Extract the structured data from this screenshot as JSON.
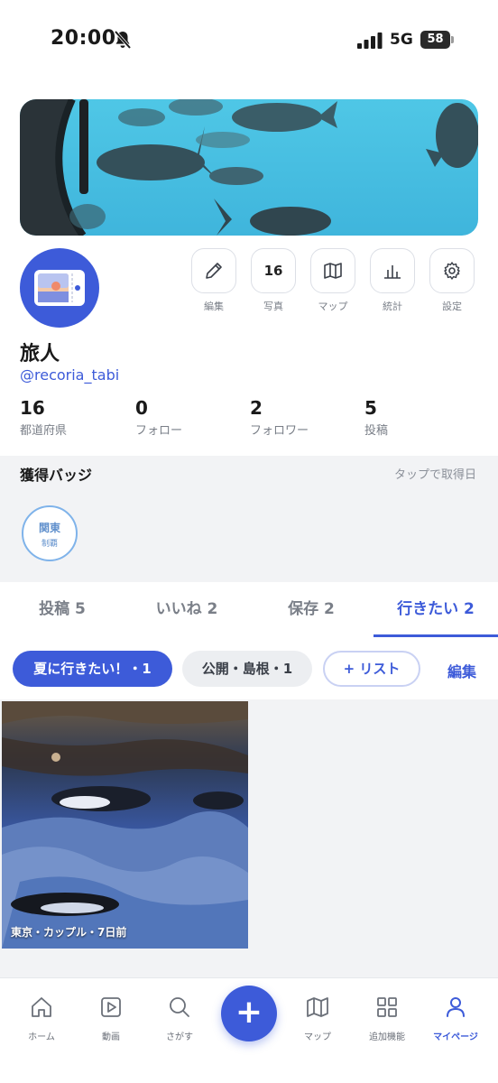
{
  "status_bar": {
    "time": "20:00",
    "network": "5G",
    "battery": "58"
  },
  "profile": {
    "name": "旅人",
    "handle": "@recoria_tabi"
  },
  "actions": [
    {
      "label": "編集",
      "icon": "pencil-icon"
    },
    {
      "label": "写真",
      "count": "16",
      "icon": "photos-count"
    },
    {
      "label": "マップ",
      "icon": "map-icon"
    },
    {
      "label": "統計",
      "icon": "bar-chart-icon"
    },
    {
      "label": "設定",
      "icon": "gear-icon"
    }
  ],
  "stats": [
    {
      "value": "16",
      "label": "都道府県"
    },
    {
      "value": "0",
      "label": "フォロー"
    },
    {
      "value": "2",
      "label": "フォロワー"
    },
    {
      "value": "5",
      "label": "投稿"
    }
  ],
  "badges": {
    "title": "獲得バッジ",
    "hint": "タップで取得日",
    "items": [
      {
        "line1": "関東",
        "line2": "制覇"
      }
    ]
  },
  "tabs": [
    {
      "label": "投稿 5"
    },
    {
      "label": "いいね 2"
    },
    {
      "label": "保存 2"
    },
    {
      "label": "行きたい 2",
      "active": true
    }
  ],
  "lists": {
    "chips": [
      {
        "label": "夏に行きたい！・1",
        "selected": true
      },
      {
        "label": "公開・島根・1",
        "selected": false
      }
    ],
    "add_label": "+ リスト",
    "edit_label": "編集"
  },
  "posts": [
    {
      "caption": "東京・カップル・7日前"
    }
  ],
  "nav": [
    {
      "label": "ホーム",
      "icon": "home-icon"
    },
    {
      "label": "動画",
      "icon": "video-icon"
    },
    {
      "label": "さがす",
      "icon": "search-icon"
    },
    {
      "label": "マップ",
      "icon": "map-icon"
    },
    {
      "label": "追加機能",
      "icon": "grid-icon"
    },
    {
      "label": "マイページ",
      "icon": "user-icon",
      "active": true
    }
  ],
  "colors": {
    "accent": "#3d5bd9",
    "background_gray": "#f2f3f5",
    "badge_blue": "#7fb3ea"
  }
}
